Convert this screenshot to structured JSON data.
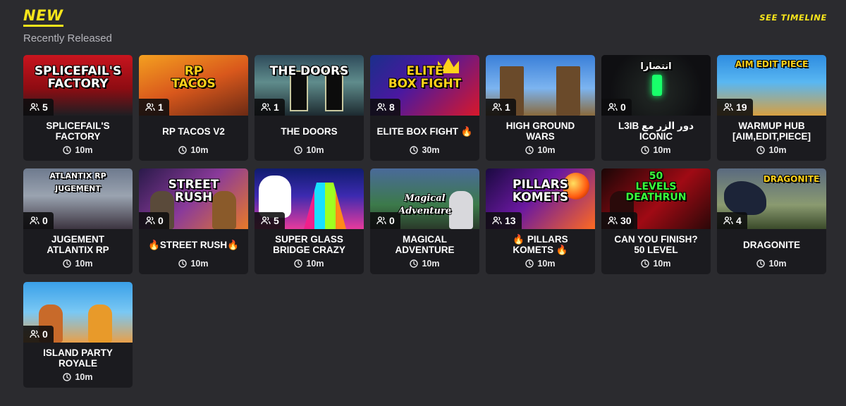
{
  "header": {
    "title": "NEW",
    "subtitle": "Recently Released",
    "see_timeline": "SEE TIMELINE"
  },
  "colors": {
    "background": "#2b2b2f",
    "card": "#1b1b1f",
    "accent": "#f7e51b"
  },
  "cards": [
    {
      "thumb_title": "SPLICEFAIL'S\nFACTORY",
      "players": "5",
      "name": "SPLICEFAIL'S\nFACTORY",
      "time": "10m"
    },
    {
      "thumb_title": "RP\nTACOS",
      "players": "1",
      "name": "RP TACOS V2",
      "time": "10m"
    },
    {
      "thumb_title": "THE DOORS",
      "players": "1",
      "name": "THE DOORS",
      "time": "10m"
    },
    {
      "thumb_title": "ELITE\nBOX FIGHT",
      "players": "8",
      "name": "ELITE BOX FIGHT 🔥",
      "time": "30m"
    },
    {
      "thumb_title": "",
      "players": "1",
      "name": "HIGH GROUND\nWARS",
      "time": "10m"
    },
    {
      "thumb_title": "انتصارا",
      "players": "0",
      "name": "L3IB دور الزر مع\nICONIC",
      "time": "10m"
    },
    {
      "thumb_title": "AIM EDIT PIECE",
      "players": "19",
      "name": "WARMUP HUB\n[AIM,EDIT,PIECE]",
      "time": "10m"
    },
    {
      "thumb_title": "ATLANTIX RP\nJUGEMENT",
      "players": "0",
      "name": "JUGEMENT\nATLANTIX RP",
      "time": "10m"
    },
    {
      "thumb_title": "STREET\nRUSH",
      "players": "0",
      "name": "🔥STREET RUSH🔥",
      "time": "10m"
    },
    {
      "thumb_title": "",
      "players": "5",
      "name": "SUPER GLASS\nBRIDGE CRAZY",
      "time": "10m"
    },
    {
      "thumb_title": "Magical\nAdventure",
      "players": "0",
      "name": "MAGICAL\nADVENTURE",
      "time": "10m"
    },
    {
      "thumb_title": "PILLARS\nKOMETS",
      "players": "13",
      "name": "🔥 PILLARS\nKOMETS 🔥",
      "time": "10m"
    },
    {
      "thumb_title": "50\nLEVELS\nDEATHRUN",
      "players": "30",
      "name": "CAN YOU FINISH?\n50 LEVEL",
      "time": "10m"
    },
    {
      "thumb_title": "DRAGONITE",
      "players": "4",
      "name": "DRAGONITE",
      "time": "10m"
    },
    {
      "thumb_title": "",
      "players": "0",
      "name": "ISLAND PARTY\nROYALE",
      "time": "10m"
    }
  ]
}
